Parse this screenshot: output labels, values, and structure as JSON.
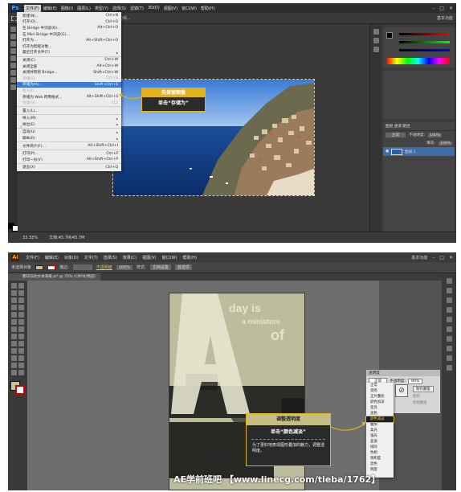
{
  "ps": {
    "logo": "Ps",
    "menus": [
      "文件(F)",
      "编辑(E)",
      "图像(I)",
      "图层(L)",
      "类型(Y)",
      "选择(S)",
      "滤镜(T)",
      "3D(D)",
      "视图(V)",
      "窗口(W)",
      "帮助(H)"
    ],
    "options_text": "调整边缘...",
    "workspace": "基本功能",
    "file_menu": [
      {
        "label": "新建(N)...",
        "shortcut": "Ctrl+N"
      },
      {
        "label": "打开(O)...",
        "shortcut": "Ctrl+O"
      },
      {
        "label": "在 Bridge 中浏览(B)...",
        "shortcut": "Alt+Ctrl+O"
      },
      {
        "label": "在 Mini Bridge 中浏览(G)...",
        "shortcut": ""
      },
      {
        "label": "打开为...",
        "shortcut": "Alt+Shift+Ctrl+O"
      },
      {
        "label": "打开为智能对象...",
        "shortcut": ""
      },
      {
        "label": "最近打开文件(T)",
        "shortcut": "▸"
      },
      {
        "label": "sep"
      },
      {
        "label": "关闭(C)",
        "shortcut": "Ctrl+W"
      },
      {
        "label": "关闭全部",
        "shortcut": "Alt+Ctrl+W"
      },
      {
        "label": "关闭并转到 Bridge...",
        "shortcut": "Shift+Ctrl+W"
      },
      {
        "label": "存储(S)",
        "shortcut": "Ctrl+S",
        "disabled": true
      },
      {
        "label": "存储为(A)...",
        "shortcut": "Shift+Ctrl+S",
        "highlight": true
      },
      {
        "label": "签入(I)...",
        "shortcut": "",
        "disabled": true
      },
      {
        "label": "存储为 Web 所用格式...",
        "shortcut": "Alt+Shift+Ctrl+S"
      },
      {
        "label": "恢复(V)",
        "shortcut": "F12",
        "disabled": true
      },
      {
        "label": "sep"
      },
      {
        "label": "置入(L)...",
        "shortcut": ""
      },
      {
        "label": "sep"
      },
      {
        "label": "导入(M)",
        "shortcut": "▸"
      },
      {
        "label": "导出(E)",
        "shortcut": "▸"
      },
      {
        "label": "sep"
      },
      {
        "label": "自动(U)",
        "shortcut": "▸"
      },
      {
        "label": "脚本(R)",
        "shortcut": "▸"
      },
      {
        "label": "sep"
      },
      {
        "label": "文件简介(F)...",
        "shortcut": "Alt+Shift+Ctrl+I"
      },
      {
        "label": "sep"
      },
      {
        "label": "打印(P)...",
        "shortcut": "Ctrl+P"
      },
      {
        "label": "打印一份(Y)",
        "shortcut": "Alt+Shift+Ctrl+P"
      },
      {
        "label": "sep"
      },
      {
        "label": "退出(X)",
        "shortcut": "Ctrl+Q"
      }
    ],
    "callout_top": "先保留图像",
    "callout_bottom": "单击“存储为”",
    "layers": {
      "tabs": "图层  通道  路径",
      "mode": "正常",
      "opacity_label": "不透明度:",
      "opacity": "100%",
      "fill_label": "填充:",
      "fill": "100%",
      "layer_name": "图层 1"
    },
    "status": "33.33%",
    "doc_info": "文档:45.7M/45.7M"
  },
  "ai": {
    "logo": "Ai",
    "menus": [
      "文件(F)",
      "编辑(E)",
      "对象(O)",
      "文字(T)",
      "选择(S)",
      "效果(C)",
      "视图(V)",
      "窗口(W)",
      "帮助(H)"
    ],
    "workspace": "基本功能",
    "options": {
      "no_selection": "未选择对象",
      "stroke": "描边:",
      "opacity": "不透明度",
      "opacity_val": "100%",
      "style": "样式:",
      "doc_setup": "文档设置",
      "prefs": "首选项"
    },
    "doc_tab": "都日双效文本海报.ai* @ 70% (CMYK/预览)",
    "zoom": "70%",
    "poster": {
      "big_letter": "A",
      "line1": "day is",
      "line2": "a miniature",
      "line3": "of"
    },
    "transparency": {
      "tab": "透明度",
      "mode": "正常",
      "opacity_label": "不透明度:",
      "opacity": "80%",
      "btn1": "制作蒙版",
      "opt1": "剪切",
      "opt2": "反相蒙版"
    },
    "blend_modes": [
      "正常",
      "变暗",
      "正片叠底",
      "颜色加深",
      "变亮",
      "滤色",
      "颜色减淡",
      "叠加",
      "柔光",
      "强光",
      "差值",
      "排除",
      "色相",
      "饱和度",
      "混色",
      "明度"
    ],
    "blend_highlight_index": 6,
    "callout_top": "调整透明度",
    "callout_mid": "单击“颜色减淡”",
    "callout_bottom": "为了更好地表现图形叠加的魅力，调整透明度。",
    "watermark": "AE学前班吧  【www.linecg.com/tieba/1762】"
  }
}
